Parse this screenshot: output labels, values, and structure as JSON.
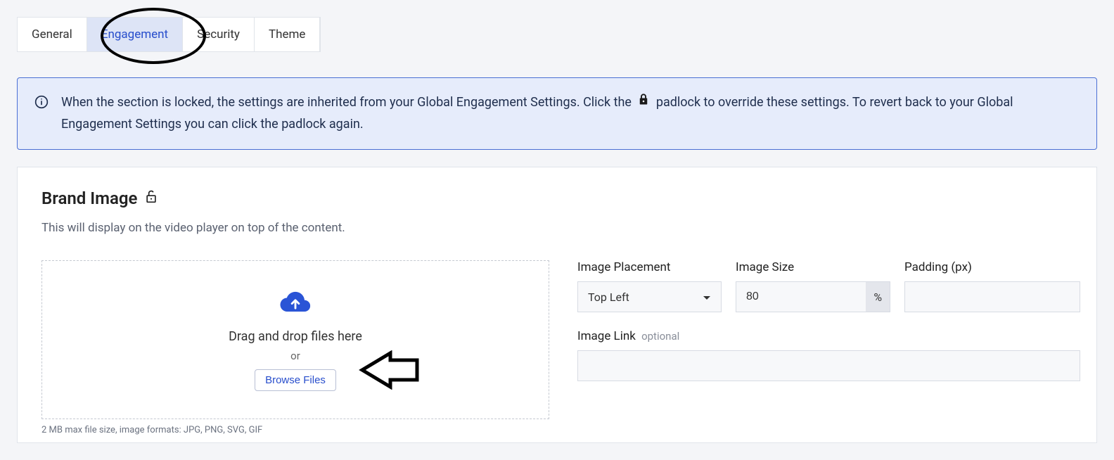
{
  "tabs": {
    "general": "General",
    "engagement": "Engagement",
    "security": "Security",
    "theme": "Theme"
  },
  "info": {
    "text_pre": "When the section is locked, the settings are inherited from your Global Engagement Settings. Click the ",
    "text_post": " padlock to override these settings. To revert back to your Global Engagement Settings you can click the padlock again."
  },
  "section": {
    "title": "Brand Image",
    "description": "This will display on the video player on top of the content."
  },
  "upload": {
    "drop_text": "Drag and drop files here",
    "or_text": "or",
    "browse_label": "Browse Files",
    "hint": "2 MB max file size, image formats: JPG, PNG, SVG, GIF"
  },
  "fields": {
    "placement_label": "Image Placement",
    "placement_value": "Top Left",
    "size_label": "Image Size",
    "size_value": "80",
    "size_unit": "%",
    "padding_label": "Padding (px)",
    "padding_value": "",
    "link_label": "Image Link",
    "link_optional": "optional",
    "link_value": ""
  }
}
